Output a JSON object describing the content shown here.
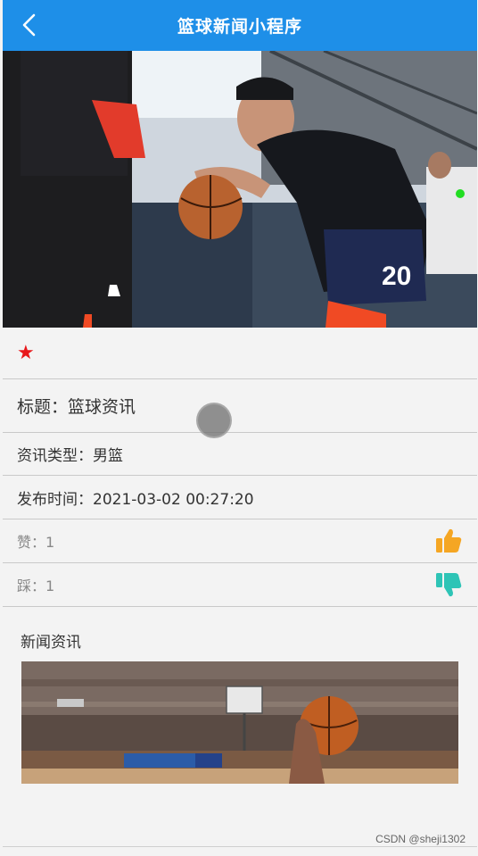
{
  "header": {
    "title": "篮球新闻小程序",
    "back_icon": "chevron-left-icon"
  },
  "hero": {
    "description_icon": "basketball-photo"
  },
  "detail": {
    "star_icon": "★",
    "title_text": "标题：篮球资讯",
    "type_text": "资讯类型：男篮",
    "time_text": "发布时间：2021-03-02 00:27:20",
    "like_text": "赞：1",
    "dislike_text": "踩：1"
  },
  "colors": {
    "header_bg": "#1e8fe8",
    "star": "#e8181b",
    "like_icon": "#f5a623",
    "dislike_icon": "#2ec4b6"
  },
  "news": {
    "heading": "新闻资讯"
  },
  "watermark": "CSDN @sheji1302"
}
